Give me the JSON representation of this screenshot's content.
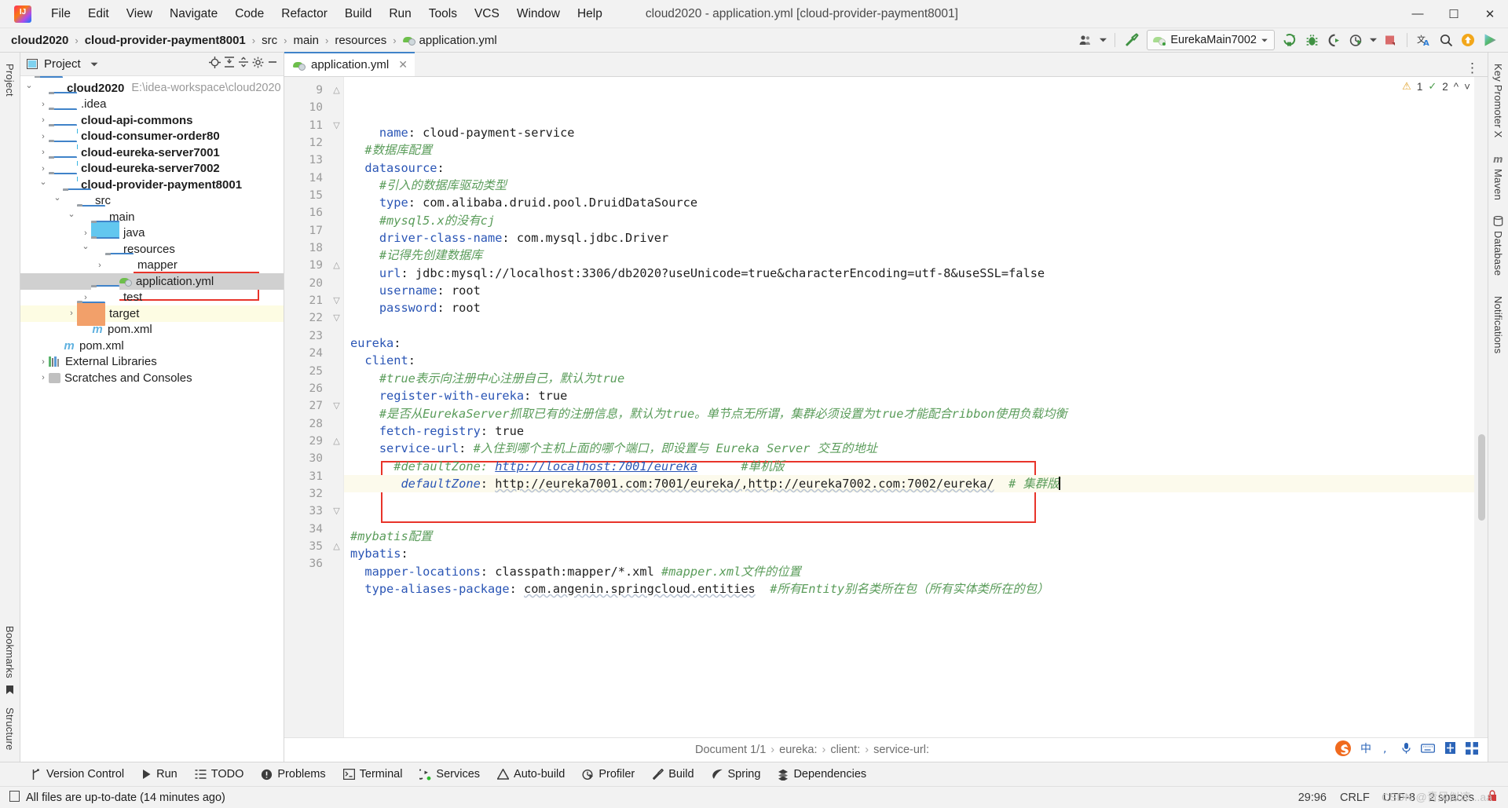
{
  "window": {
    "title": "cloud2020 - application.yml [cloud-provider-payment8001]",
    "minimize": "─",
    "maximize": "☐",
    "close": "✕"
  },
  "menu": [
    {
      "label": "File"
    },
    {
      "label": "Edit"
    },
    {
      "label": "View"
    },
    {
      "label": "Navigate"
    },
    {
      "label": "Code"
    },
    {
      "label": "Refactor"
    },
    {
      "label": "Build"
    },
    {
      "label": "Run"
    },
    {
      "label": "Tools"
    },
    {
      "label": "VCS"
    },
    {
      "label": "Window"
    },
    {
      "label": "Help"
    }
  ],
  "breadcrumb": {
    "items": [
      "cloud2020",
      "cloud-provider-payment8001",
      "src",
      "main",
      "resources",
      "application.yml"
    ],
    "separator": "›"
  },
  "toolbar": {
    "run_config": "EurekaMain7002",
    "icons": [
      "user-group-icon",
      "hammer-build-icon",
      "run-icon",
      "debug-icon",
      "run-with-coverage-icon",
      "profiler-icon",
      "stop-icon",
      "translate-icon",
      "search-icon",
      "update-icon",
      "play-green-icon"
    ]
  },
  "project_panel": {
    "title": "Project",
    "header_icons": [
      "locate-icon",
      "expand-all-icon",
      "collapse-all-icon",
      "settings-gear-icon",
      "hide-icon"
    ],
    "tree": [
      {
        "label": "cloud2020",
        "path": "E:\\idea-workspace\\cloud2020",
        "indent": 0,
        "chevron": "down",
        "icon": "module-folder",
        "bold": true
      },
      {
        "label": ".idea",
        "indent": 1,
        "chevron": "right",
        "icon": "folder",
        "bold": false
      },
      {
        "label": "cloud-api-commons",
        "indent": 1,
        "chevron": "right",
        "icon": "module-folder",
        "bold": true
      },
      {
        "label": "cloud-consumer-order80",
        "indent": 1,
        "chevron": "right",
        "icon": "module-folder",
        "bold": true
      },
      {
        "label": "cloud-eureka-server7001",
        "indent": 1,
        "chevron": "right",
        "icon": "module-folder",
        "bold": true
      },
      {
        "label": "cloud-eureka-server7002",
        "indent": 1,
        "chevron": "right",
        "icon": "module-folder",
        "bold": true
      },
      {
        "label": "cloud-provider-payment8001",
        "indent": 1,
        "chevron": "down",
        "icon": "module-folder",
        "bold": true
      },
      {
        "label": "src",
        "indent": 2,
        "chevron": "down",
        "icon": "folder",
        "bold": false
      },
      {
        "label": "main",
        "indent": 3,
        "chevron": "down",
        "icon": "folder",
        "bold": false
      },
      {
        "label": "java",
        "indent": 4,
        "chevron": "right",
        "icon": "source-folder",
        "bold": false
      },
      {
        "label": "resources",
        "indent": 4,
        "chevron": "down",
        "icon": "resource-folder",
        "bold": false
      },
      {
        "label": "mapper",
        "indent": 5,
        "chevron": "right",
        "icon": "folder",
        "bold": false
      },
      {
        "label": "application.yml",
        "indent": 6,
        "chevron": "none",
        "icon": "yml-file",
        "bold": false,
        "selected": true
      },
      {
        "label": "test",
        "indent": 4,
        "chevron": "right",
        "icon": "folder",
        "bold": false
      },
      {
        "label": "target",
        "indent": 3,
        "chevron": "right",
        "icon": "target-folder",
        "bold": false,
        "highlight": true
      },
      {
        "label": "pom.xml",
        "indent": 4,
        "chevron": "none",
        "icon": "maven-file",
        "bold": false
      },
      {
        "label": "pom.xml",
        "indent": 2,
        "chevron": "none",
        "icon": "maven-file",
        "bold": false
      },
      {
        "label": "External Libraries",
        "indent": 1,
        "chevron": "right",
        "icon": "library",
        "bold": false
      },
      {
        "label": "Scratches and Consoles",
        "indent": 1,
        "chevron": "right",
        "icon": "scratch",
        "bold": false
      }
    ]
  },
  "left_strip": [
    "Project",
    "Bookmarks",
    "Structure"
  ],
  "right_strip": [
    "Key Promoter X",
    "Maven",
    "Database",
    "Notifications"
  ],
  "editor": {
    "tab": {
      "label": "application.yml",
      "close": "✕",
      "icon": "yml-file"
    },
    "inspections": {
      "warnings": "1",
      "weak_warnings": "2",
      "warning_icon": "warning-triangle-icon",
      "weak_icon": "weak-warning-icon",
      "chevron_up": "⌃",
      "chevron_down": "⌄"
    },
    "first_line_number": 9,
    "current_line": 29,
    "lines": [
      {
        "n": 9,
        "fold": "end",
        "tokens": [
          {
            "t": "    ",
            "c": "v"
          },
          {
            "t": "name",
            "c": "k"
          },
          {
            "t": ": ",
            "c": "v"
          },
          {
            "t": "cloud-payment-service",
            "c": "v"
          }
        ]
      },
      {
        "n": 10,
        "fold": "",
        "tokens": [
          {
            "t": "  ",
            "c": "v"
          },
          {
            "t": "#数据库配置",
            "c": "c"
          }
        ]
      },
      {
        "n": 11,
        "fold": "open",
        "tokens": [
          {
            "t": "  ",
            "c": "v"
          },
          {
            "t": "datasource",
            "c": "k"
          },
          {
            "t": ":",
            "c": "v"
          }
        ]
      },
      {
        "n": 12,
        "fold": "",
        "tokens": [
          {
            "t": "    ",
            "c": "v"
          },
          {
            "t": "#引入的数据库驱动类型",
            "c": "c"
          }
        ]
      },
      {
        "n": 13,
        "fold": "",
        "tokens": [
          {
            "t": "    ",
            "c": "v"
          },
          {
            "t": "type",
            "c": "k"
          },
          {
            "t": ": ",
            "c": "v"
          },
          {
            "t": "com.alibaba.druid.pool.DruidDataSource",
            "c": "v"
          }
        ]
      },
      {
        "n": 14,
        "fold": "",
        "tokens": [
          {
            "t": "    ",
            "c": "v"
          },
          {
            "t": "#mysql5.x的没有cj",
            "c": "c"
          }
        ]
      },
      {
        "n": 15,
        "fold": "",
        "tokens": [
          {
            "t": "    ",
            "c": "v"
          },
          {
            "t": "driver-class-name",
            "c": "k"
          },
          {
            "t": ": ",
            "c": "v"
          },
          {
            "t": "com.mysql.jdbc.Driver",
            "c": "v"
          }
        ]
      },
      {
        "n": 16,
        "fold": "",
        "tokens": [
          {
            "t": "    ",
            "c": "v"
          },
          {
            "t": "#记得先创建数据库",
            "c": "c"
          }
        ]
      },
      {
        "n": 17,
        "fold": "",
        "tokens": [
          {
            "t": "    ",
            "c": "v"
          },
          {
            "t": "url",
            "c": "k"
          },
          {
            "t": ": ",
            "c": "v"
          },
          {
            "t": "jdbc:mysql://localhost:3306/db2020?useUnicode=true&characterEncoding=utf-8&useSSL=false",
            "c": "v"
          }
        ]
      },
      {
        "n": 18,
        "fold": "",
        "tokens": [
          {
            "t": "    ",
            "c": "v"
          },
          {
            "t": "username",
            "c": "k"
          },
          {
            "t": ": ",
            "c": "v"
          },
          {
            "t": "root",
            "c": "v"
          }
        ]
      },
      {
        "n": 19,
        "fold": "end",
        "tokens": [
          {
            "t": "    ",
            "c": "v"
          },
          {
            "t": "password",
            "c": "k"
          },
          {
            "t": ": ",
            "c": "v"
          },
          {
            "t": "root",
            "c": "v"
          }
        ]
      },
      {
        "n": 20,
        "fold": "",
        "tokens": [
          {
            "t": "",
            "c": "v"
          }
        ]
      },
      {
        "n": 21,
        "fold": "open",
        "tokens": [
          {
            "t": "eureka",
            "c": "k"
          },
          {
            "t": ":",
            "c": "v"
          }
        ]
      },
      {
        "n": 22,
        "fold": "open",
        "tokens": [
          {
            "t": "  ",
            "c": "v"
          },
          {
            "t": "client",
            "c": "k"
          },
          {
            "t": ":",
            "c": "v"
          }
        ]
      },
      {
        "n": 23,
        "fold": "",
        "tokens": [
          {
            "t": "    ",
            "c": "v"
          },
          {
            "t": "#true表示向注册中心注册自己，默认为true",
            "c": "c"
          }
        ]
      },
      {
        "n": 24,
        "fold": "",
        "tokens": [
          {
            "t": "    ",
            "c": "v"
          },
          {
            "t": "register-with-eureka",
            "c": "k"
          },
          {
            "t": ": ",
            "c": "v"
          },
          {
            "t": "true",
            "c": "v"
          }
        ]
      },
      {
        "n": 25,
        "fold": "",
        "tokens": [
          {
            "t": "    ",
            "c": "v"
          },
          {
            "t": "#是否从EurekaServer抓取已有的注册信息，默认为true。单节点无所谓，集群必须设置为true才能配合ribbon使用负载均衡",
            "c": "c"
          }
        ]
      },
      {
        "n": 26,
        "fold": "",
        "tokens": [
          {
            "t": "    ",
            "c": "v"
          },
          {
            "t": "fetch-registry",
            "c": "k"
          },
          {
            "t": ": ",
            "c": "v"
          },
          {
            "t": "true",
            "c": "v"
          }
        ]
      },
      {
        "n": 27,
        "fold": "open",
        "tokens": [
          {
            "t": "    ",
            "c": "v"
          },
          {
            "t": "service-url",
            "c": "k"
          },
          {
            "t": ": ",
            "c": "v"
          },
          {
            "t": "#入住到哪个主机上面的哪个端口，即设置与 Eureka Server 交互的地址",
            "c": "c"
          }
        ]
      },
      {
        "n": 28,
        "fold": "",
        "tokens": [
          {
            "t": "      ",
            "c": "v"
          },
          {
            "t": "#defaultZone: ",
            "c": "c"
          },
          {
            "t": "http://localhost:7001/eureka",
            "c": "lnk-c"
          },
          {
            "t": "      ",
            "c": "v"
          },
          {
            "t": "#单机版",
            "c": "c"
          }
        ]
      },
      {
        "n": 29,
        "fold": "end",
        "current": true,
        "tokens": [
          {
            "t": "       ",
            "c": "v"
          },
          {
            "t": "defaultZone",
            "c": "k-i"
          },
          {
            "t": ": ",
            "c": "v"
          },
          {
            "t": "http://eureka7001.com:7001/eureka/,http://eureka7002.com:7002/eureka/",
            "c": "v-w"
          },
          {
            "t": "  ",
            "c": "v"
          },
          {
            "t": "# 集群版",
            "c": "c"
          },
          {
            "t": "|",
            "c": "caret"
          }
        ]
      },
      {
        "n": 30,
        "fold": "",
        "tokens": [
          {
            "t": "",
            "c": "v"
          }
        ]
      },
      {
        "n": 31,
        "fold": "",
        "tokens": [
          {
            "t": "",
            "c": "v"
          }
        ]
      },
      {
        "n": 32,
        "fold": "",
        "tokens": [
          {
            "t": "",
            "c": "v"
          },
          {
            "t": "#mybatis配置",
            "c": "c"
          }
        ]
      },
      {
        "n": 33,
        "fold": "open",
        "tokens": [
          {
            "t": "mybatis",
            "c": "k"
          },
          {
            "t": ":",
            "c": "v"
          }
        ]
      },
      {
        "n": 34,
        "fold": "",
        "tokens": [
          {
            "t": "  ",
            "c": "v"
          },
          {
            "t": "mapper-locations",
            "c": "k"
          },
          {
            "t": ": ",
            "c": "v"
          },
          {
            "t": "classpath:mapper/*.xml ",
            "c": "v"
          },
          {
            "t": "#mapper.xml文件的位置",
            "c": "c"
          }
        ]
      },
      {
        "n": 35,
        "fold": "end",
        "tokens": [
          {
            "t": "  ",
            "c": "v"
          },
          {
            "t": "type-aliases-package",
            "c": "k"
          },
          {
            "t": ": ",
            "c": "v"
          },
          {
            "t": "com.angenin.springcloud.entities",
            "c": "v-w"
          },
          {
            "t": "  ",
            "c": "v"
          },
          {
            "t": "#所有Entity别名类所在包（所有实体类所在的包）",
            "c": "c"
          }
        ]
      },
      {
        "n": 36,
        "fold": "",
        "tokens": [
          {
            "t": "",
            "c": "v"
          }
        ]
      }
    ]
  },
  "document_bar": {
    "label": "Document 1/1",
    "crumbs": [
      "eureka:",
      "client:",
      "service-url:"
    ],
    "separator": "›"
  },
  "tool_windows": [
    {
      "label": "Version Control",
      "icon": "branch-icon"
    },
    {
      "label": "Run",
      "icon": "play-icon"
    },
    {
      "label": "TODO",
      "icon": "list-icon"
    },
    {
      "label": "Problems",
      "icon": "exclamation-circle-icon"
    },
    {
      "label": "Terminal",
      "icon": "terminal-icon"
    },
    {
      "label": "Services",
      "icon": "services-icon"
    },
    {
      "label": "Auto-build",
      "icon": "warning-triangle-icon"
    },
    {
      "label": "Profiler",
      "icon": "profiler-icon"
    },
    {
      "label": "Build",
      "icon": "hammer-icon"
    },
    {
      "label": "Spring",
      "icon": "spring-leaf-icon"
    },
    {
      "label": "Dependencies",
      "icon": "dependencies-icon"
    }
  ],
  "status_bar": {
    "message": "All files are up-to-date (14 minutes ago)",
    "message_icon": "document-icon",
    "caret_position": "29:96",
    "line_separator": "CRLF",
    "encoding": "UTF-8",
    "indent": "2 spaces",
    "lock_icon": "read-write-icon"
  },
  "tray": {
    "icons": [
      "sogou-icon",
      "chinese-mode-icon",
      "comma-icon",
      "mic-icon",
      "keyboard-icon",
      "toolbox-icon",
      "apps-icon"
    ]
  },
  "watermark": "CSDN @青风似凉...aa",
  "colors": {
    "accent": "#4083c9",
    "highlight_box": "#e8342a",
    "keyword": "#2a55b5",
    "comment": "#5a9c5a",
    "selection": "#d0d0d0",
    "current_line": "#fcfaec"
  }
}
